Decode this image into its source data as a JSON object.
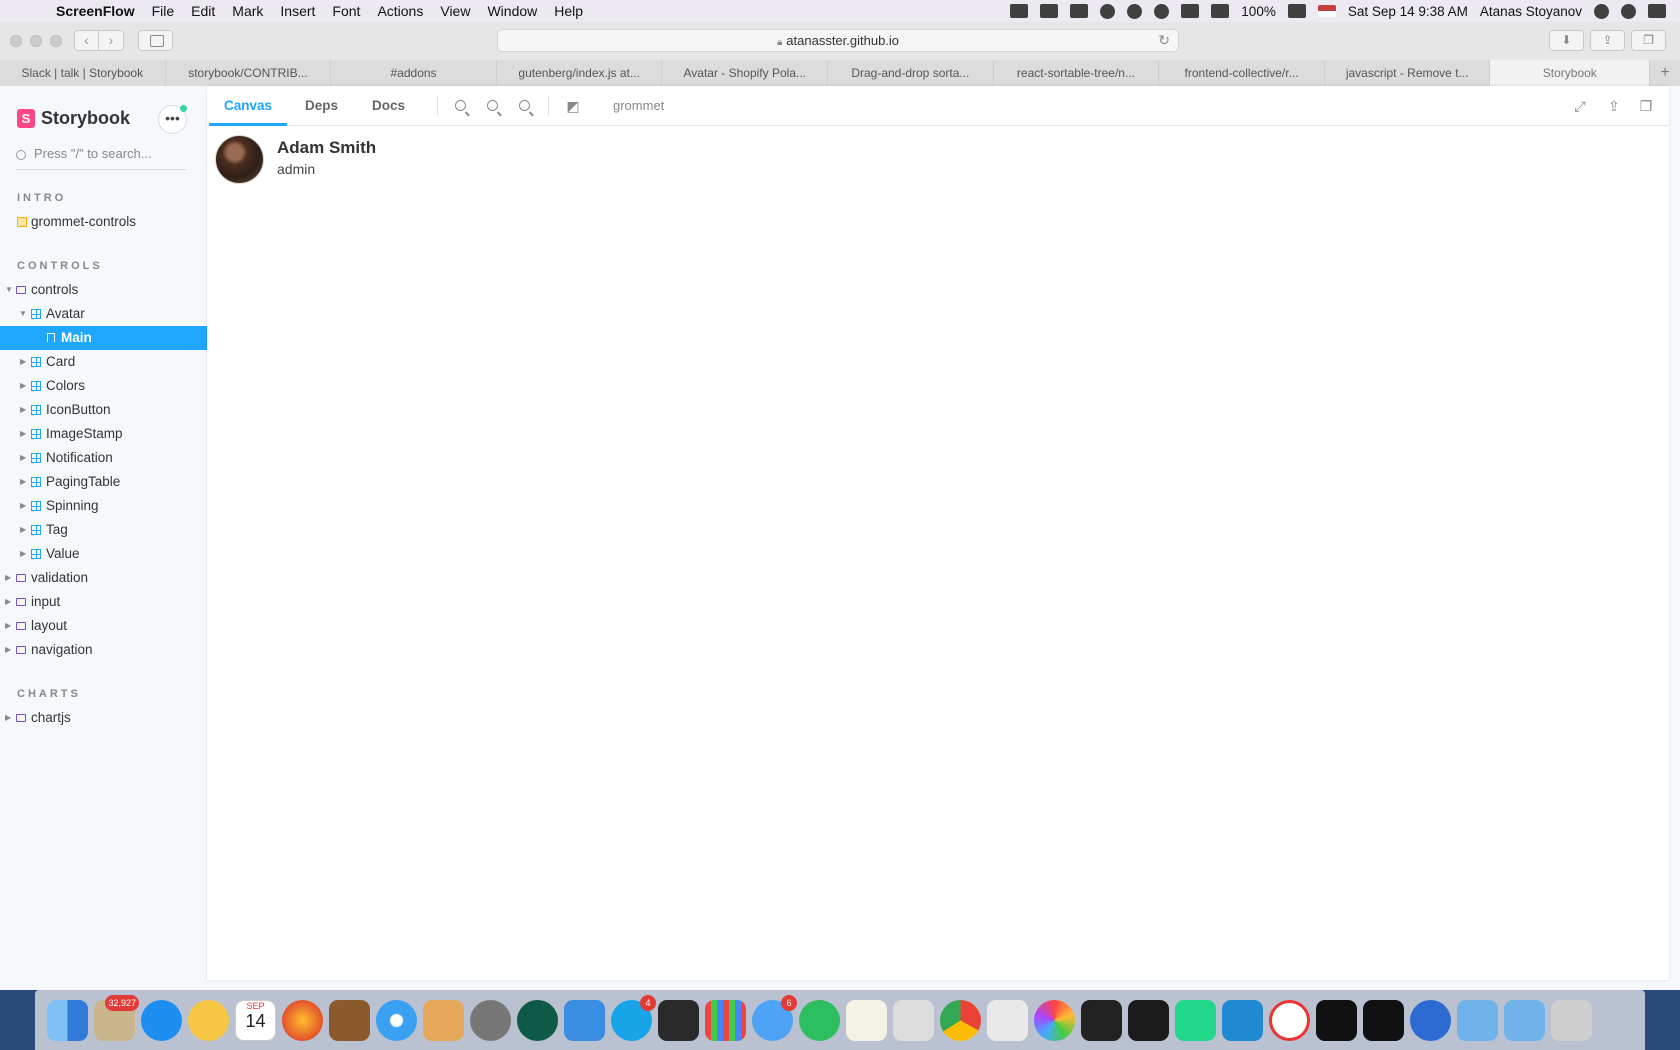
{
  "menubar": {
    "app": "ScreenFlow",
    "items": [
      "File",
      "Edit",
      "Mark",
      "Insert",
      "Font",
      "Actions",
      "View",
      "Window",
      "Help"
    ],
    "battery": "100%",
    "datetime": "Sat Sep 14  9:38 AM",
    "user": "Atanas Stoyanov"
  },
  "browser": {
    "url": "atanasster.github.io",
    "tabs": [
      "Slack | talk | Storybook",
      "storybook/CONTRIB...",
      "#addons",
      "gutenberg/index.js at...",
      "Avatar - Shopify Pola...",
      "Drag-and-drop sorta...",
      "react-sortable-tree/n...",
      "frontend-collective/r...",
      "javascript - Remove t...",
      "Storybook"
    ],
    "new_tab": "+"
  },
  "storybook": {
    "brand": "Storybook",
    "menu_icon": "ellipsis-icon",
    "search_placeholder": "Press \"/\" to search...",
    "sections": {
      "intro": "INTRO",
      "controls": "CONTROLS",
      "charts": "CHARTS"
    },
    "tree": {
      "grommet_controls": "grommet-controls",
      "controls": "controls",
      "avatar": "Avatar",
      "main": "Main",
      "card": "Card",
      "colors": "Colors",
      "iconbutton": "IconButton",
      "imagestamp": "ImageStamp",
      "notification": "Notification",
      "pagingtable": "PagingTable",
      "spinning": "Spinning",
      "tag": "Tag",
      "value": "Value",
      "validation": "validation",
      "input": "input",
      "layout": "layout",
      "navigation": "navigation",
      "chartjs": "chartjs"
    },
    "toolbar": {
      "tabs": [
        "Canvas",
        "Deps",
        "Docs"
      ],
      "active_tab": "Canvas",
      "theme": "grommet"
    },
    "preview": {
      "name": "Adam Smith",
      "role": "admin"
    },
    "accent": "#1ea7fd"
  },
  "dock": {
    "mail_badge": "32,927",
    "skype_badge": "4",
    "messages_badge": "6",
    "calendar_month": "SEP",
    "calendar_day": "14"
  }
}
